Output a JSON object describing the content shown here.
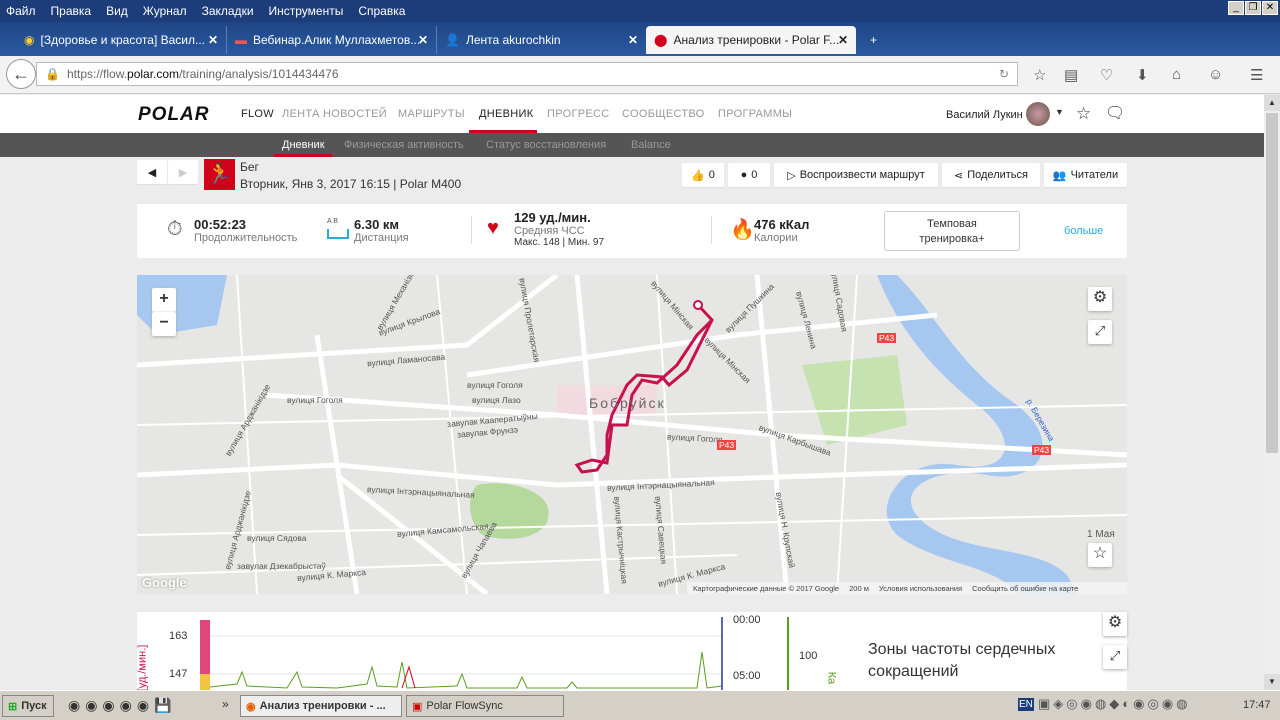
{
  "menu": [
    "Файл",
    "Правка",
    "Вид",
    "Журнал",
    "Закладки",
    "Инструменты",
    "Справка"
  ],
  "tabs": [
    {
      "label": "[Здоровье и красота] Васил..."
    },
    {
      "label": "Вебинар.Алик Муллахметов..."
    },
    {
      "label": "Лента akurochkin"
    },
    {
      "label": "Анализ тренировки - Polar F..."
    }
  ],
  "url": {
    "pre": "https://flow.",
    "host": "polar.com",
    "post": "/training/analysis/1014434476"
  },
  "header": {
    "logo": "POLAR",
    "flow": "FLOW",
    "nav": [
      "ЛЕНТА НОВОСТЕЙ",
      "МАРШРУТЫ",
      "ДНЕВНИК",
      "ПРОГРЕСС",
      "СООБЩЕСТВО",
      "ПРОГРАММЫ"
    ],
    "user": "Василий Лукин"
  },
  "subnav": [
    "Дневник",
    "Физическая активность",
    "Статус восстановления",
    "Balance"
  ],
  "activity": {
    "sport": "Бег",
    "date": "Вторник, Янв 3, 2017 16:15 | Polar M400",
    "likes": "0",
    "comments": "0",
    "replay": "Воспроизвести маршрут",
    "share": "Поделиться",
    "readers": "Читатели"
  },
  "summary": {
    "duration": "00:52:23",
    "duration_label": "Продолжительность",
    "distance": "6.30 км",
    "distance_label": "Дистанция",
    "ab": "A  B",
    "hr": "129 уд./мин.",
    "hr_label": "Средняя ЧСС",
    "hr_minmax": "Макс. 148  |  Мин. 97",
    "calories": "476 кКал",
    "calories_label": "Калории",
    "training_type": "Темповая тренировка+",
    "more": "больше"
  },
  "map": {
    "city": "Бобруйск",
    "streets": [
      "вулиця Гоголя",
      "вулиця Крылова",
      "вулиця Механізіа",
      "вулиця Ламаносава",
      "вулиця Гоголя",
      "вулиця Лазо",
      "вулиця Арджанікідзе",
      "вулиця Арджанікідзе",
      "завулак Кааператыўны",
      "завулак Фрунзэ",
      "вулиця Інтэрнацыянальная",
      "вулиця Інтэрнацыянальная",
      "вулиця Камсамольская",
      "вулиця Сядова",
      "вулиця К. Маркса",
      "вулиця К. Маркса",
      "вулиця Мінская",
      "вулиця Мінская",
      "вулиця Пушкина",
      "вулиця Гоголя",
      "вулиця Карбышава",
      "вулиця Ленина",
      "вулиця Кастрычніцкая",
      "вулиця Савецкая",
      "вулиця Н. Крупскай",
      "р. Березина",
      "1 Мая",
      "вулиця Чапаева",
      "завулак Дзекабрыстаў",
      "вулиця Пролетарская",
      "вулиця Садовая"
    ],
    "roads": [
      "P43",
      "P43",
      "P43"
    ],
    "attribution": "Картографические данные © 2017 Google",
    "scale": "200 м",
    "terms": "Условия использования",
    "report": "Сообщить об ошибке на карте",
    "google": "Google"
  },
  "chart": {
    "y_ticks": [
      "163",
      "147"
    ],
    "y_label": "[уд./мин.]",
    "time_ticks": [
      "00:00",
      "05:00"
    ],
    "right_tick": "100",
    "right_label": "Ка",
    "zones_title": "Зоны частоты сердечных сокращений"
  },
  "taskbar": {
    "start": "Пуск",
    "items": [
      "Анализ тренировки - ...",
      "Polar FlowSync"
    ],
    "lang": "EN",
    "clock": "17:47"
  }
}
